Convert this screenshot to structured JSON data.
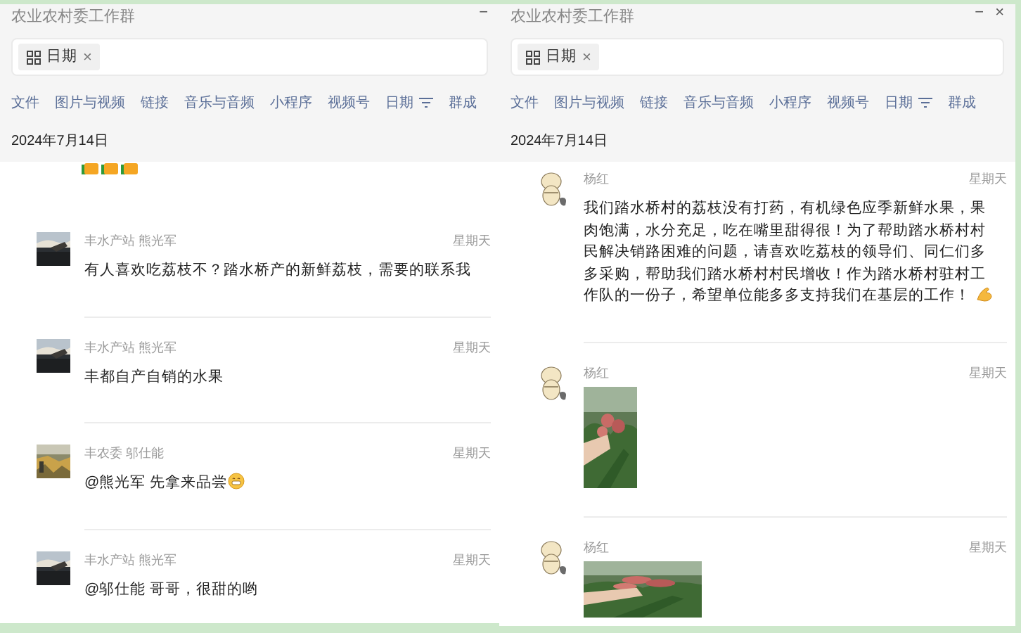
{
  "windows": [
    {
      "title": "农业农村委工作群",
      "controls": [
        "−"
      ],
      "search": {
        "chip": "日期",
        "chip_close": "×"
      },
      "tabs": [
        {
          "label": "文件",
          "kind": "plain"
        },
        {
          "label": "图片与视频",
          "kind": "plain"
        },
        {
          "label": "链接",
          "kind": "plain"
        },
        {
          "label": "音乐与音频",
          "kind": "plain"
        },
        {
          "label": "小程序",
          "kind": "plain"
        },
        {
          "label": "视频号",
          "kind": "plain"
        },
        {
          "label": "日期",
          "kind": "filter"
        },
        {
          "label": "群成",
          "kind": "plain"
        }
      ],
      "date": "2024年7月14日",
      "messages": [
        {
          "kind": "emoji_row"
        },
        {
          "kind": "text",
          "sender": "丰水产站 熊光军",
          "time": "星期天",
          "avatar": {
            "kind": "landscape"
          },
          "text": "有人喜欢吃荔枝不？踏水桥产的新鲜荔枝，需要的联系我"
        },
        {
          "kind": "text",
          "sender": "丰水产站 熊光军",
          "time": "星期天",
          "avatar": {
            "kind": "landscape"
          },
          "text": "丰都自产自销的水果"
        },
        {
          "kind": "text_grin",
          "sender": "丰农委 邬仕能",
          "time": "星期天",
          "avatar": {
            "kind": "field"
          },
          "text": "@熊光军 先拿来品尝"
        },
        {
          "kind": "text",
          "sender": "丰水产站 熊光军",
          "time": "星期天",
          "avatar": {
            "kind": "landscape"
          },
          "text": "@邬仕能 哥哥，很甜的哟"
        }
      ]
    },
    {
      "title": "农业农村委工作群",
      "controls": [
        "−",
        "×"
      ],
      "search": {
        "chip": "日期",
        "chip_close": "×"
      },
      "tabs": [
        {
          "label": "文件",
          "kind": "plain"
        },
        {
          "label": "图片与视频",
          "kind": "plain"
        },
        {
          "label": "链接",
          "kind": "plain"
        },
        {
          "label": "音乐与音频",
          "kind": "plain"
        },
        {
          "label": "小程序",
          "kind": "plain"
        },
        {
          "label": "视频号",
          "kind": "plain"
        },
        {
          "label": "日期",
          "kind": "filter"
        },
        {
          "label": "群成",
          "kind": "plain"
        }
      ],
      "date": "2024年7月14日",
      "messages": [
        {
          "kind": "text_arm",
          "sender": "杨红",
          "time": "星期天",
          "avatar": {
            "kind": "cartoon"
          },
          "text": "我们踏水桥村的荔枝没有打药，有机绿色应季新鲜水果，果肉饱满，水分充足，吃在嘴里甜得很！为了帮助踏水桥村村民解决销路困难的问题，请喜欢吃荔枝的领导们、同仁们多多采购，帮助我们踏水桥村村民增收！作为踏水桥村驻村工作队的一份子，希望单位能多多支持我们在基层的工作！"
        },
        {
          "sender": "杨红",
          "time": "星期天",
          "avatar": {
            "kind": "cartoon"
          },
          "picture": {
            "kind": "tall"
          }
        },
        {
          "sender": "杨红",
          "time": "星期天",
          "avatar": {
            "kind": "cartoon"
          },
          "picture": {
            "kind": "wide"
          }
        }
      ]
    }
  ]
}
